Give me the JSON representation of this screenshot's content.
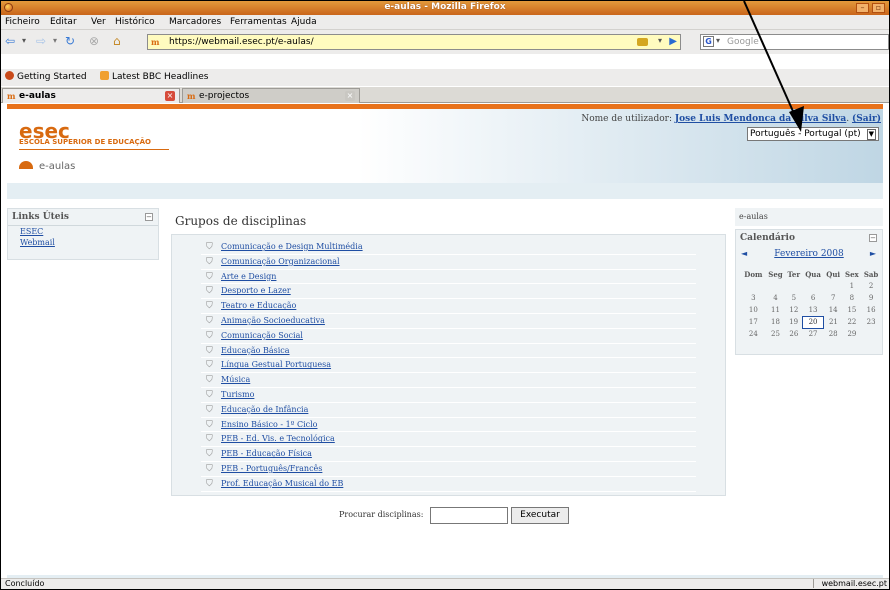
{
  "window": {
    "title": "e-aulas - Mozilla Firefox"
  },
  "menu": [
    "Ficheiro",
    "Editar",
    "Ver",
    "Histórico",
    "Marcadores",
    "Ferramentas",
    "Ajuda"
  ],
  "nav": {
    "url": "https://webmail.esec.pt/e-aulas/",
    "search_placeholder": "Google"
  },
  "bookmarks": [
    {
      "label": "Getting Started",
      "icon": "firefox-icon"
    },
    {
      "label": "Latest BBC Headlines",
      "icon": "rss-icon"
    }
  ],
  "tabs": [
    {
      "label": "e-aulas",
      "active": true
    },
    {
      "label": "e-projectos",
      "active": false
    }
  ],
  "header": {
    "logo": "esec",
    "logo_sub": "ESCOLA SUPERIOR DE EDUCAÇÃO",
    "site_link": "e-aulas",
    "login_prefix": "Nome de utilizador:",
    "user_name": "Jose Luis Mendonca da Silva Silva",
    "logout": "(Sair)",
    "language": "Português - Portugal (pt)"
  },
  "links_block": {
    "title": "Links Úteis",
    "links": [
      "ESEC",
      "Webmail"
    ]
  },
  "main": {
    "title": "Grupos de disciplinas",
    "categories": [
      "Comunicação e Design Multimédia",
      "Comunicação Organizacional",
      "Arte e Design",
      "Desporto e Lazer",
      "Teatro e Educação",
      "Animação Socioeducativa",
      "Comunicação Social",
      "Educação Básica",
      "Língua Gestual Portuguesa",
      "Música",
      "Turismo",
      "Educação de Infância",
      "Ensino Básico - 1º Ciclo",
      "PEB - Ed. Vis. e Tecnológica",
      "PEB - Educação Física",
      "PEB - Português/Francês",
      "Prof. Educação Musical do EB"
    ],
    "search_label": "Procurar disciplinas:",
    "search_button": "Executar"
  },
  "right_block": {
    "title": "e-aulas"
  },
  "calendar": {
    "title": "Calendário",
    "prev": "◄",
    "next": "►",
    "month": "Fevereiro 2008",
    "weekdays": [
      "Dom",
      "Seg",
      "Ter",
      "Qua",
      "Qui",
      "Sex",
      "Sab"
    ],
    "weeks": [
      [
        "",
        "",
        "",
        "",
        "",
        "1",
        "2"
      ],
      [
        "3",
        "4",
        "5",
        "6",
        "7",
        "8",
        "9"
      ],
      [
        "10",
        "11",
        "12",
        "13",
        "14",
        "15",
        "16"
      ],
      [
        "17",
        "18",
        "19",
        "20",
        "21",
        "22",
        "23"
      ],
      [
        "24",
        "25",
        "26",
        "27",
        "28",
        "29",
        ""
      ]
    ],
    "today": "20"
  },
  "status": {
    "text": "Concluído",
    "host": "webmail.esec.pt"
  },
  "colors": {
    "accent": "#e8721b",
    "link": "#1f4ea3",
    "block_bg": "#eff3f5"
  }
}
